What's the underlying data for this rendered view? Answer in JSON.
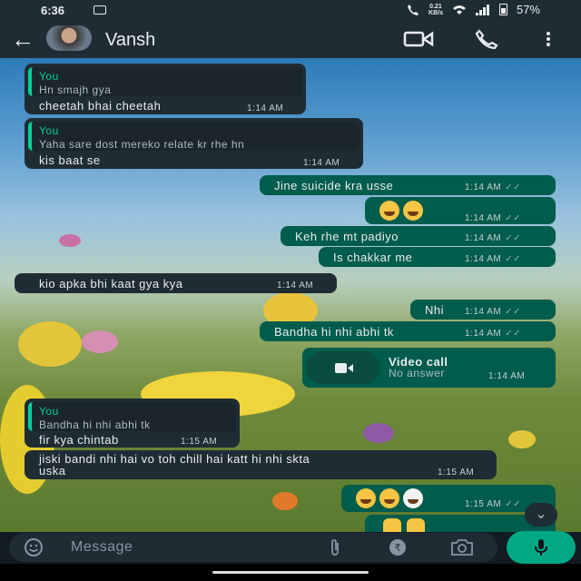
{
  "status_bar": {
    "time": "6:36",
    "net_speed": "0.21",
    "net_unit": "KB/s",
    "battery": "57%"
  },
  "header": {
    "contact_name": "Vansh",
    "back_icon": "arrow-left-icon",
    "video_icon": "video-call-icon",
    "call_icon": "phone-icon",
    "menu_icon": "more-vertical-icon"
  },
  "messages": [
    {
      "dir": "in",
      "quote_author": "You",
      "quote_text": "Hn smajh gya",
      "text": "cheetah bhai cheetah",
      "time": "1:14 AM"
    },
    {
      "dir": "in",
      "quote_author": "You",
      "quote_text": "Yaha sare dost mereko relate kr rhe hn",
      "text": "kis baat se",
      "time": "1:14 AM"
    },
    {
      "dir": "out",
      "text": "Jine suicide kra usse",
      "time": "1:14 AM"
    },
    {
      "dir": "out",
      "emoji": "crying-face-emoji",
      "time": "1:14 AM"
    },
    {
      "dir": "out",
      "text": "Keh rhe mt padiyo",
      "time": "1:14 AM"
    },
    {
      "dir": "out",
      "text": "Is chakkar me",
      "time": "1:14 AM"
    },
    {
      "dir": "in",
      "text": "kio apka bhi kaat gya kya",
      "time": "1:14 AM"
    },
    {
      "dir": "out",
      "text": "Nhi",
      "time": "1:14 AM"
    },
    {
      "dir": "out",
      "text": "Bandha hi nhi abhi tk",
      "time": "1:14 AM"
    },
    {
      "dir": "out",
      "type": "call",
      "title": "Video call",
      "subtitle": "No answer",
      "time": "1:14 AM"
    },
    {
      "dir": "in",
      "quote_author": "You",
      "quote_text": "Bandha hi nhi abhi tk",
      "text": "fir kya chintab",
      "time": "1:15 AM"
    },
    {
      "dir": "in",
      "text_line1": "jiski bandi nhi hai vo toh chill hai katt hi nhi skta",
      "text_line2": "uska",
      "time": "1:15 AM"
    },
    {
      "dir": "out",
      "emoji": "laughing-emoji",
      "time": "1:15 AM"
    },
    {
      "dir": "out",
      "emoji": "thumbs-up-emoji"
    }
  ],
  "composer": {
    "placeholder": "Message",
    "emoji_icon": "emoji-icon",
    "attach_icon": "paperclip-icon",
    "payment_icon": "rupee-icon",
    "camera_icon": "camera-icon",
    "mic_icon": "mic-icon"
  },
  "colors": {
    "incoming": "#1f2c34",
    "outgoing": "#005c4b",
    "accent": "#00a884",
    "quote_author": "#06cf9c"
  }
}
